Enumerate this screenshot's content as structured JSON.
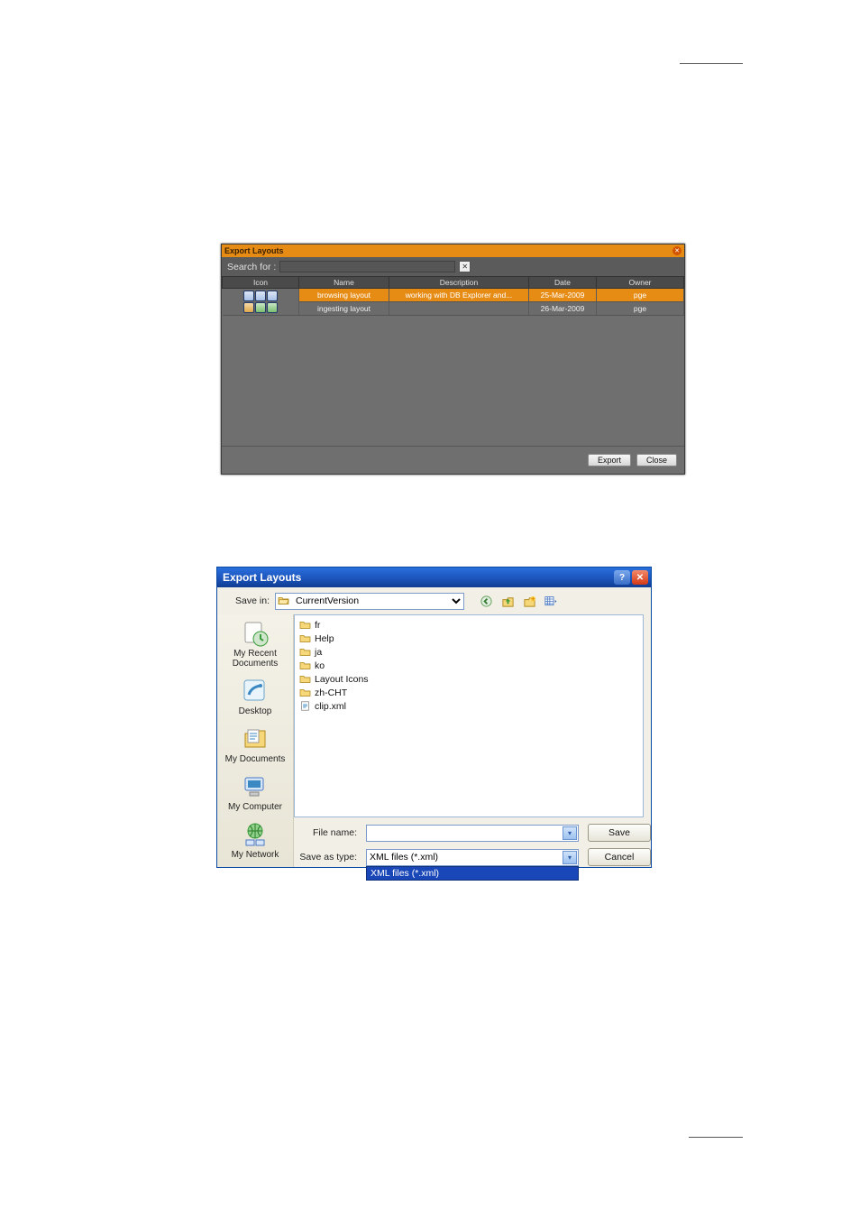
{
  "dlg1": {
    "title": "Export Layouts",
    "search_label": "Search for :",
    "columns": [
      "Icon",
      "Name",
      "Description",
      "Date",
      "Owner"
    ],
    "rows": [
      {
        "name": "browsing layout",
        "description": "working with DB Explorer and...",
        "date": "25-Mar-2009",
        "owner": "pge",
        "selected": true
      },
      {
        "name": "ingesting layout",
        "description": "",
        "date": "26-Mar-2009",
        "owner": "pge",
        "selected": false
      }
    ],
    "buttons": {
      "export": "Export",
      "close": "Close"
    }
  },
  "dlg2": {
    "title": "Export Layouts",
    "savein_label": "Save in:",
    "savein_value": "CurrentVersion",
    "places": [
      "My Recent Documents",
      "Desktop",
      "My Documents",
      "My Computer",
      "My Network"
    ],
    "files": [
      {
        "name": "fr",
        "type": "folder"
      },
      {
        "name": "Help",
        "type": "folder"
      },
      {
        "name": "ja",
        "type": "folder"
      },
      {
        "name": "ko",
        "type": "folder"
      },
      {
        "name": "Layout Icons",
        "type": "folder"
      },
      {
        "name": "zh-CHT",
        "type": "folder"
      },
      {
        "name": "clip.xml",
        "type": "xml"
      }
    ],
    "filename_label": "File name:",
    "filename_value": "",
    "saveas_label": "Save as type:",
    "saveas_value": "XML files (*.xml)",
    "saveas_dropdown_open": "XML files (*.xml)",
    "buttons": {
      "save": "Save",
      "cancel": "Cancel"
    }
  }
}
